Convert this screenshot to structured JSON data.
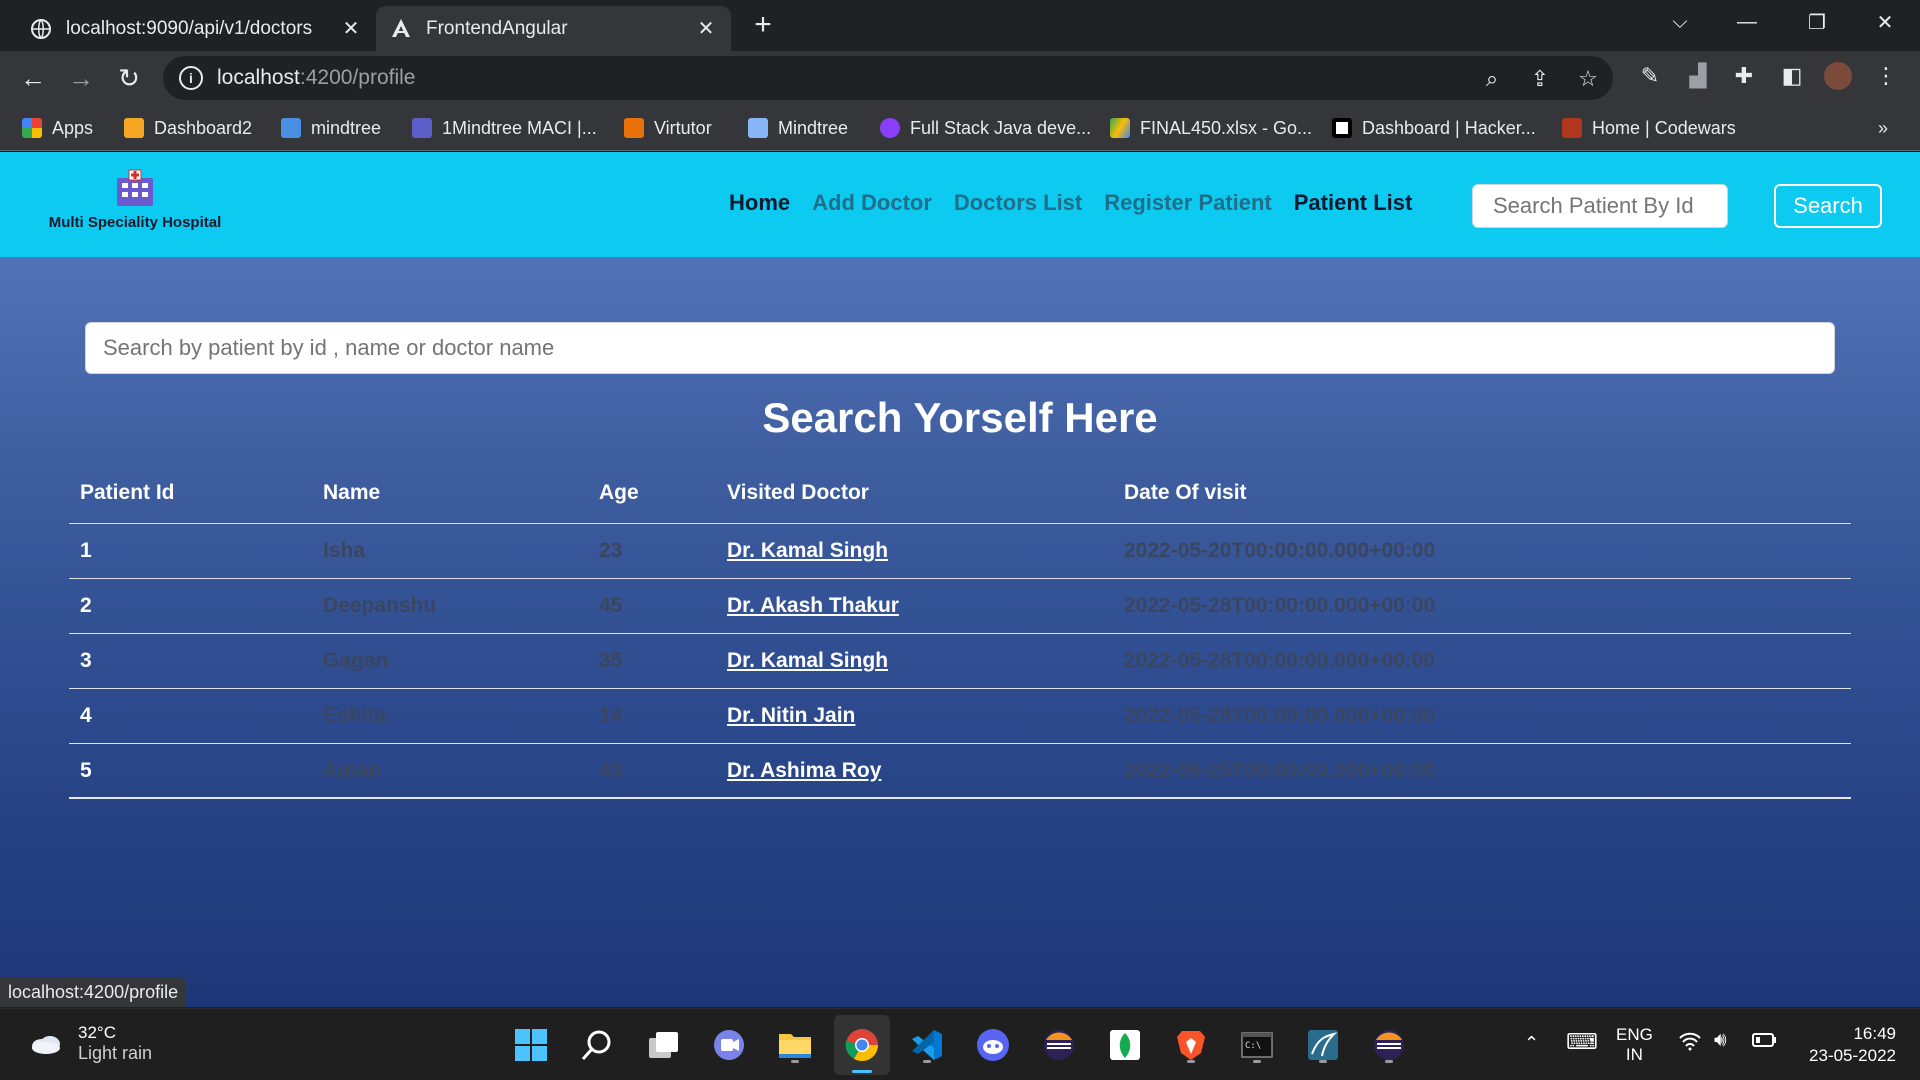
{
  "browser": {
    "tabs": [
      {
        "title": "localhost:9090/api/v1/doctors",
        "favicon": "globe-icon",
        "close": "✕"
      },
      {
        "title": "FrontendAngular",
        "favicon": "angular-icon",
        "close": "✕"
      }
    ],
    "new_tab": "+",
    "window_controls": {
      "dropdown": "⌵",
      "minimize": "—",
      "restore": "❐",
      "close": "✕"
    },
    "address": {
      "host": "localhost",
      "rest": ":4200/profile"
    },
    "bookmarks": [
      {
        "label": "Apps",
        "color": "#4285f4"
      },
      {
        "label": "Dashboard2",
        "color": "#f6a623"
      },
      {
        "label": "mindtree",
        "color": "#4a90e2"
      },
      {
        "label": "1Mindtree MACI |...",
        "color": "#5b5fc7"
      },
      {
        "label": "Virtutor",
        "color": "#e8710a"
      },
      {
        "label": "Mindtree",
        "color": "#8ab4f8"
      },
      {
        "label": "Full Stack Java deve...",
        "color": "#8a3ffc"
      },
      {
        "label": "FINAL450.xlsx - Go...",
        "color": "#34a853"
      },
      {
        "label": "Dashboard | Hacker...",
        "color": "#ffffff"
      },
      {
        "label": "Home | Codewars",
        "color": "#b1361e"
      }
    ],
    "more": "»",
    "status_url": "localhost:4200/profile"
  },
  "app": {
    "brand": "Multi Speciality Hospital",
    "nav": [
      {
        "label": "Home",
        "style": "dark"
      },
      {
        "label": "Add Doctor",
        "style": "muted"
      },
      {
        "label": "Doctors List",
        "style": "muted"
      },
      {
        "label": "Register Patient",
        "style": "muted"
      },
      {
        "label": "Patient List",
        "style": "dark"
      }
    ],
    "nav_search_placeholder": "Search Patient By Id",
    "nav_search_button": "Search",
    "main_search_placeholder": "Search by patient by id , name or doctor name",
    "heading": "Search Yorself Here",
    "table": {
      "headers": [
        "Patient Id",
        "Name",
        "Age",
        "Visited Doctor",
        "Date Of visit"
      ],
      "rows": [
        [
          "1",
          "Isha",
          "23",
          "Dr. Kamal Singh",
          "2022-05-20T00:00:00.000+00:00"
        ],
        [
          "2",
          "Deepanshu",
          "45",
          "Dr. Akash Thakur",
          "2022-05-28T00:00:00.000+00:00"
        ],
        [
          "3",
          "Gagan",
          "35",
          "Dr. Kamal Singh",
          "2022-05-28T00:00:00.000+00:00"
        ],
        [
          "4",
          "Eshita",
          "14",
          "Dr. Nitin Jain",
          "2022-05-28T00:00:00.000+00:00"
        ],
        [
          "5",
          "Aman",
          "43",
          "Dr. Ashima Roy",
          "2022-06-25T00:00:00.000+00:00"
        ]
      ]
    }
  },
  "taskbar": {
    "weather": {
      "temp": "32°C",
      "desc": "Light rain"
    },
    "lang": {
      "line1": "ENG",
      "line2": "IN"
    },
    "time": "16:49",
    "date": "23-05-2022",
    "apps": [
      "windows-start",
      "search",
      "task-view",
      "teams-chat",
      "file-explorer",
      "chrome",
      "vscode",
      "discord",
      "eclipse",
      "mongodb-compass",
      "brave",
      "terminal",
      "mysql-workbench",
      "eclipse-2"
    ]
  }
}
